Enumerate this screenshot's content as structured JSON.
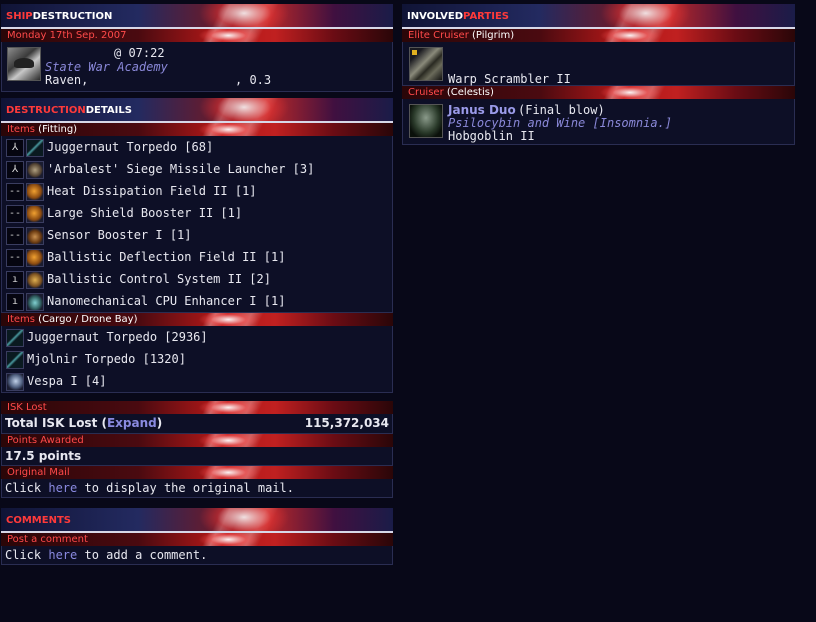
{
  "ship_destruction": {
    "header_red": "SHIP",
    "header_white": "DESTRUCTION",
    "date": "Monday 17th Sep. 2007",
    "time": "@ 07:22",
    "corp": "State War Academy",
    "ship_name": "Raven,",
    "security": ", 0.3"
  },
  "destruction_details": {
    "header_red": "DESTRUCTION",
    "header_white": "DETAILS",
    "fitting_label": "Items",
    "fitting_paren": "(Fitting)",
    "fitting": [
      {
        "slot": "⅄",
        "icon": "torp",
        "name": "Juggernaut Torpedo [68]"
      },
      {
        "slot": "⅄",
        "icon": "launcher",
        "name": "'Arbalest' Siege Missile Launcher [3]"
      },
      {
        "slot": "--",
        "icon": "heat",
        "name": "Heat Dissipation Field II [1]"
      },
      {
        "slot": "--",
        "icon": "heat",
        "name": "Large Shield Booster II [1]"
      },
      {
        "slot": "--",
        "icon": "sensor",
        "name": "Sensor Booster I [1]"
      },
      {
        "slot": "--",
        "icon": "heat",
        "name": "Ballistic Deflection Field II [1]"
      },
      {
        "slot": "ı",
        "icon": "bcs",
        "name": "Ballistic Control System II [2]"
      },
      {
        "slot": "ı",
        "icon": "cpu",
        "name": "Nanomechanical CPU Enhancer I [1]"
      }
    ],
    "cargo_label": "Items",
    "cargo_paren": "(Cargo / Drone Bay)",
    "cargo": [
      {
        "icon": "torp",
        "name": "Juggernaut Torpedo [2936]"
      },
      {
        "icon": "torp",
        "name": "Mjolnir Torpedo [1320]"
      },
      {
        "icon": "drone",
        "name": "Vespa I [4]"
      }
    ],
    "isk_header": "ISK Lost",
    "isk_label_pre": "Total ISK Lost (",
    "isk_link": "Expand",
    "isk_label_post": ")",
    "isk_value": "115,372,034",
    "points_header": "Points Awarded",
    "points": "17.5 points",
    "mail_header": "Original Mail",
    "mail_pre": "Click ",
    "mail_link": "here",
    "mail_post": " to display the original mail."
  },
  "comments": {
    "header_red": "COMMENTS",
    "post_header": "Post a comment",
    "pre": "Click ",
    "link": "here",
    "post": " to add a comment."
  },
  "involved_parties": {
    "header_white": "INVOLVED",
    "header_red": "PARTIES",
    "group1_label": "Elite Cruiser",
    "group1_ship": "(Pilgrim)",
    "group1_weapon": "Warp Scrambler II",
    "group2_label": "Cruiser",
    "group2_ship": "(Celestis)",
    "pilot_name": "Janus Duo",
    "pilot_note": "(Final blow)",
    "pilot_corp": "Psilocybin and Wine",
    "pilot_alliance": "[Insomnia.]",
    "pilot_weapon": "Hobgoblin II"
  }
}
